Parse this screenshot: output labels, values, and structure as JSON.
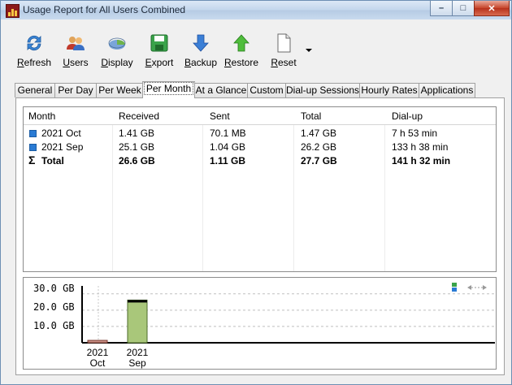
{
  "window": {
    "title": "Usage Report for All Users Combined"
  },
  "toolbar": {
    "items": [
      {
        "label": "Refresh",
        "u": "R",
        "rest": "efresh",
        "icon": "refresh-icon"
      },
      {
        "label": "Users",
        "u": "U",
        "rest": "sers",
        "icon": "users-icon"
      },
      {
        "label": "Display",
        "u": "D",
        "rest": "isplay",
        "icon": "display-icon"
      },
      {
        "label": "Export",
        "u": "E",
        "rest": "xport",
        "icon": "save-disk-icon"
      },
      {
        "label": "Backup",
        "u": "B",
        "rest": "ackup",
        "icon": "arrow-down-icon"
      },
      {
        "label": "Restore",
        "u": "R",
        "rest": "estore",
        "icon": "arrow-up-icon"
      },
      {
        "label": "Reset",
        "u": "R",
        "rest": "eset",
        "icon": "document-icon"
      }
    ]
  },
  "tabs": [
    "General",
    "Per Day",
    "Per Week",
    "Per Month",
    "At a Glance",
    "Custom",
    "Dial-up Sessions",
    "Hourly Rates",
    "Applications"
  ],
  "active_tab": "Per Month",
  "table": {
    "columns": [
      "Month",
      "Received",
      "Sent",
      "Total",
      "Dial-up"
    ],
    "rows": [
      {
        "month": "2021 Oct",
        "received": "1.41 GB",
        "sent": "70.1 MB",
        "total": "1.47 GB",
        "dialup": "7 h 53 min"
      },
      {
        "month": "2021 Sep",
        "received": "25.1 GB",
        "sent": "1.04 GB",
        "total": "26.2 GB",
        "dialup": "133 h 38 min"
      }
    ],
    "total_row": {
      "month": "Total",
      "received": "26.6 GB",
      "sent": "1.11 GB",
      "total": "27.7 GB",
      "dialup": "141 h 32 min"
    }
  },
  "chart_data": {
    "type": "bar",
    "categories": [
      "2021 Oct",
      "2021 Sep"
    ],
    "category_lines": [
      [
        "2021",
        "Oct"
      ],
      [
        "2021",
        "Sep"
      ]
    ],
    "values": [
      1.47,
      26.2
    ],
    "unit": "GB",
    "yticks": [
      "30.0 GB",
      "20.0 GB",
      "10.0 GB"
    ],
    "ytick_values": [
      30,
      20,
      10
    ],
    "ylim": [
      0,
      30
    ],
    "grid": true,
    "colors": {
      "oct": "#c98f86",
      "sep": "#a9c77a"
    }
  },
  "colors": {
    "accent": "#2a7bd4",
    "close_button": "#c7442a"
  }
}
